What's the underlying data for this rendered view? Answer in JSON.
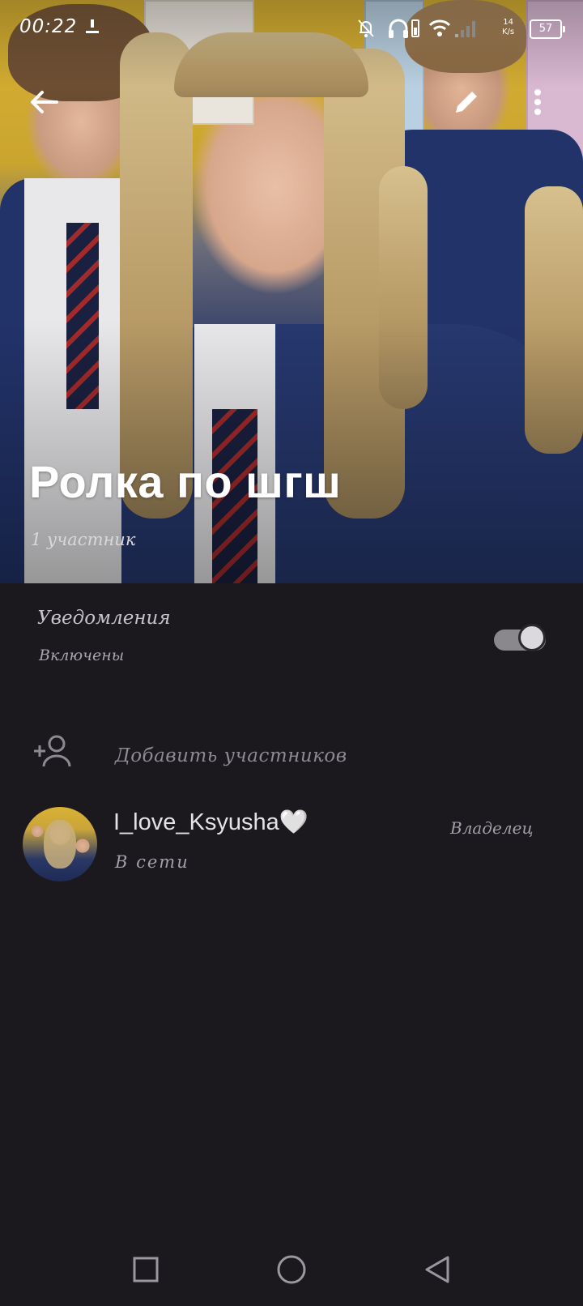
{
  "status_bar": {
    "time": "00:22",
    "net_speed_top": "14",
    "net_speed_bottom": "K/s",
    "battery": "57",
    "icons": [
      "download-icon",
      "bell-off-icon",
      "headphones-icon",
      "wifi-icon",
      "signal-icon"
    ]
  },
  "header": {
    "title": "Ролка по шгш",
    "member_count": "1 участник",
    "back_icon": "arrow-left-icon",
    "edit_icon": "pencil-icon",
    "menu_icon": "more-vertical-icon"
  },
  "notifications": {
    "title": "Уведомления",
    "status": "Включены",
    "enabled": true
  },
  "add_members": {
    "label": "Добавить участников",
    "icon": "add-user-icon"
  },
  "members": [
    {
      "name": "I_love_Ksyusha🤍",
      "status": "В сети",
      "role": "Владелец"
    }
  ],
  "nav": {
    "icons": [
      "square-icon",
      "circle-icon",
      "triangle-back-icon"
    ]
  },
  "colors": {
    "background": "#1b191d",
    "title": "#ffffff",
    "secondary_text": "#a4a0aa",
    "toggle_track": "#8a878d"
  }
}
